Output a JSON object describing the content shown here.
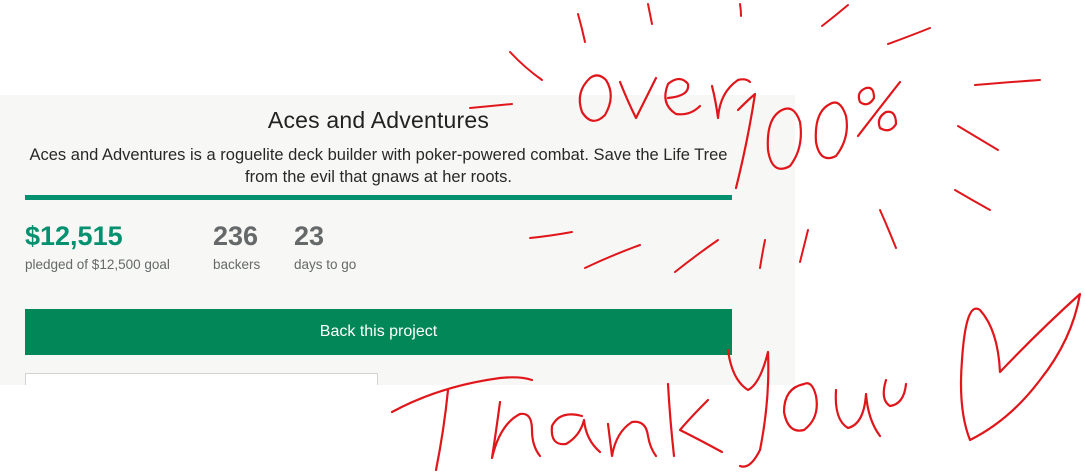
{
  "project": {
    "title": "Aces and Adventures",
    "blurb": "Aces and Adventures is a roguelite deck builder with poker-powered combat. Save the Life Tree from the evil that gnaws at her roots."
  },
  "funding": {
    "progress_percent": 100
  },
  "stats": {
    "pledged_amount": "$12,515",
    "pledged_label": "pledged of $12,500 goal",
    "backers_count": "236",
    "backers_label": "backers",
    "days_count": "23",
    "days_label": "days to go"
  },
  "actions": {
    "back_label": "Back this project"
  },
  "annotation": {
    "line1": "over",
    "line2": "100%",
    "line3": "Thank you",
    "color": "#e0161b"
  },
  "colors": {
    "accent": "#05906f",
    "button": "#028858"
  }
}
